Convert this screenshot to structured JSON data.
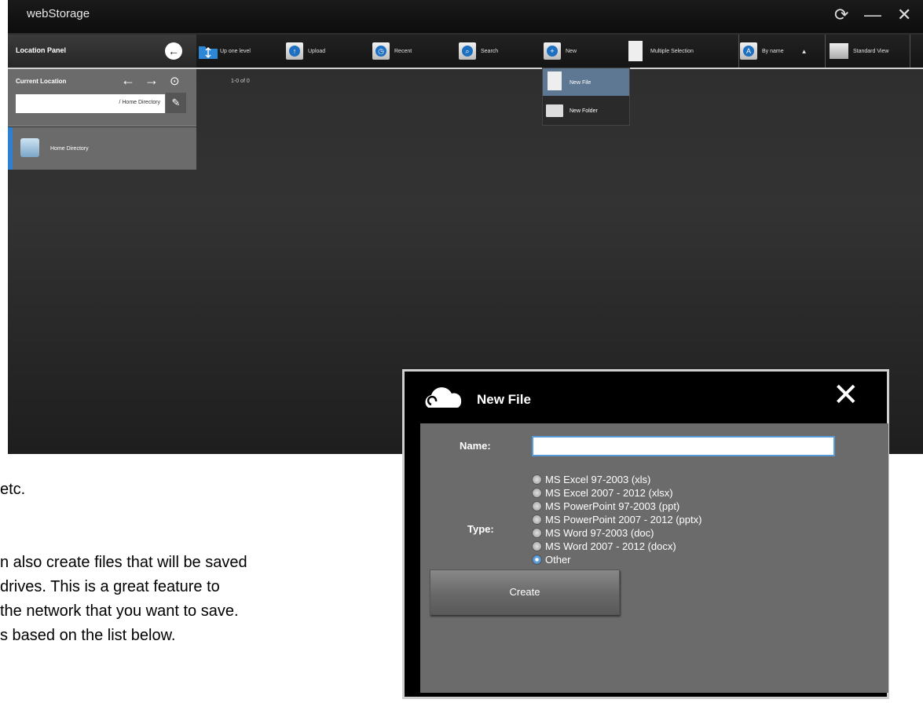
{
  "app": {
    "title": "webStorage"
  },
  "window_controls": {
    "refresh": "⟳",
    "minimize": "—",
    "close": "✕"
  },
  "location_panel": {
    "title": "Location Panel",
    "current_location_label": "Current Location",
    "path": "/ Home Directory",
    "home_item": "Home Directory"
  },
  "toolbar": {
    "up_one_level": "Up one level",
    "upload": "Upload",
    "recent": "Recent",
    "search": "Search",
    "new": "New",
    "multiple_selection": "Multiple Selection",
    "sort": "By name",
    "sort_arrow": "▲",
    "view": "Standard View"
  },
  "content": {
    "count": "1-0 of 0"
  },
  "new_menu": {
    "items": [
      "New File",
      "New Folder"
    ]
  },
  "background_text": {
    "line1": "etc.",
    "line2": "n also create files that will be saved",
    "line3": "drives.  This is a great feature to",
    "line4": "the network that you want to save.",
    "line5": "s based on the list below."
  },
  "dialog": {
    "title": "New File",
    "name_label": "Name:",
    "name_value": "",
    "type_label": "Type:",
    "types": [
      "MS Excel 97-2003 (xls)",
      "MS Excel 2007 - 2012 (xlsx)",
      "MS PowerPoint 97-2003 (ppt)",
      "MS PowerPoint 2007 - 2012 (pptx)",
      "MS Word 97-2003 (doc)",
      "MS Word 2007 - 2012 (docx)",
      "Other"
    ],
    "selected_type": "Other",
    "create_label": "Create"
  }
}
